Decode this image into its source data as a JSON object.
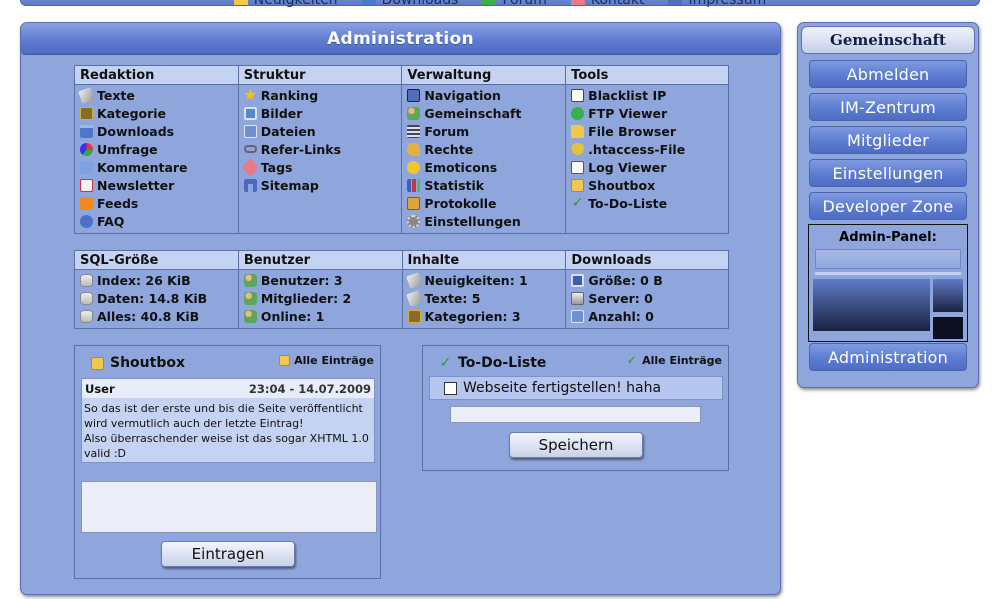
{
  "topnav": [
    {
      "label": "Neuigkeiten",
      "icon": "news-icon"
    },
    {
      "label": "Downloads",
      "icon": "download-icon"
    },
    {
      "label": "Forum",
      "icon": "forum-icon"
    },
    {
      "label": "Kontakt",
      "icon": "contact-icon"
    },
    {
      "label": "Impressum",
      "icon": "impressum-icon"
    }
  ],
  "main": {
    "title": "Administration",
    "menu": {
      "headers": [
        "Redaktion",
        "Struktur",
        "Verwaltung",
        "Tools"
      ],
      "redaktion": [
        "Texte",
        "Kategorie",
        "Downloads",
        "Umfrage",
        "Kommentare",
        "Newsletter",
        "Feeds",
        "FAQ"
      ],
      "struktur": [
        "Ranking",
        "Bilder",
        "Dateien",
        "Refer-Links",
        "Tags",
        "Sitemap"
      ],
      "verwaltung": [
        "Navigation",
        "Gemeinschaft",
        "Forum",
        "Rechte",
        "Emoticons",
        "Statistik",
        "Protokolle",
        "Einstellungen"
      ],
      "tools": [
        "Blacklist IP",
        "FTP Viewer",
        "File Browser",
        ".htaccess-File",
        "Log Viewer",
        "Shoutbox",
        "To-Do-Liste"
      ]
    },
    "stats": {
      "headers": [
        "SQL-Größe",
        "Benutzer",
        "Inhalte",
        "Downloads"
      ],
      "sql": [
        "Index: 26 KiB",
        "Daten: 14.8 KiB",
        "Alles: 40.8 KiB"
      ],
      "benutzer": [
        "Benutzer: 3",
        "Mitglieder: 2",
        "Online: 1"
      ],
      "inhalte": [
        "Neuigkeiten: 1",
        "Texte: 5",
        "Kategorien: 3"
      ],
      "downloads": [
        "Größe: 0 B",
        "Server: 0",
        "Anzahl: 0"
      ]
    },
    "shoutbox": {
      "title": "Shoutbox",
      "all_link": "Alle Einträge",
      "entry_user": "User",
      "entry_date": "23:04 - 14.07.2009",
      "entry_line1": "So das ist der erste und bis die Seite veröffentlicht",
      "entry_line2": "wird vermutlich auch der letzte Eintrag!",
      "entry_line3": "Also überraschender weise ist das sogar XHTML 1.0",
      "entry_line4": "valid :D",
      "submit_label": "Eintragen"
    },
    "todo": {
      "title": "To-Do-Liste",
      "all_link": "Alle Einträge",
      "item": "Webseite fertigstellen! haha",
      "save_label": "Speichern"
    }
  },
  "sidebar": {
    "title": "Gemeinschaft",
    "buttons": [
      "Abmelden",
      "IM-Zentrum",
      "Mitglieder",
      "Einstellungen",
      "Developer Zone"
    ],
    "admin_panel_label": "Admin-Panel:",
    "admin_button": "Administration"
  }
}
